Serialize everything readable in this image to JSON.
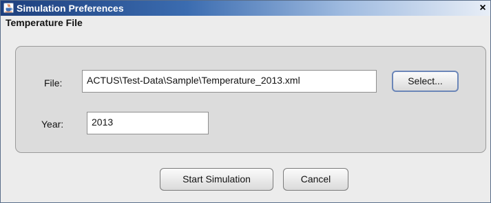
{
  "window": {
    "title": "Simulation Preferences",
    "close_label": "×"
  },
  "section": {
    "title": "Temperature File"
  },
  "file": {
    "label": "File:",
    "value": "ACTUS\\Test-Data\\Sample\\Temperature_2013.xml",
    "select_label": "Select..."
  },
  "year": {
    "label": "Year:",
    "value": "2013"
  },
  "actions": {
    "start_label": "Start Simulation",
    "cancel_label": "Cancel"
  },
  "icons": {
    "app": "java-cup-icon",
    "close": "close-icon"
  }
}
